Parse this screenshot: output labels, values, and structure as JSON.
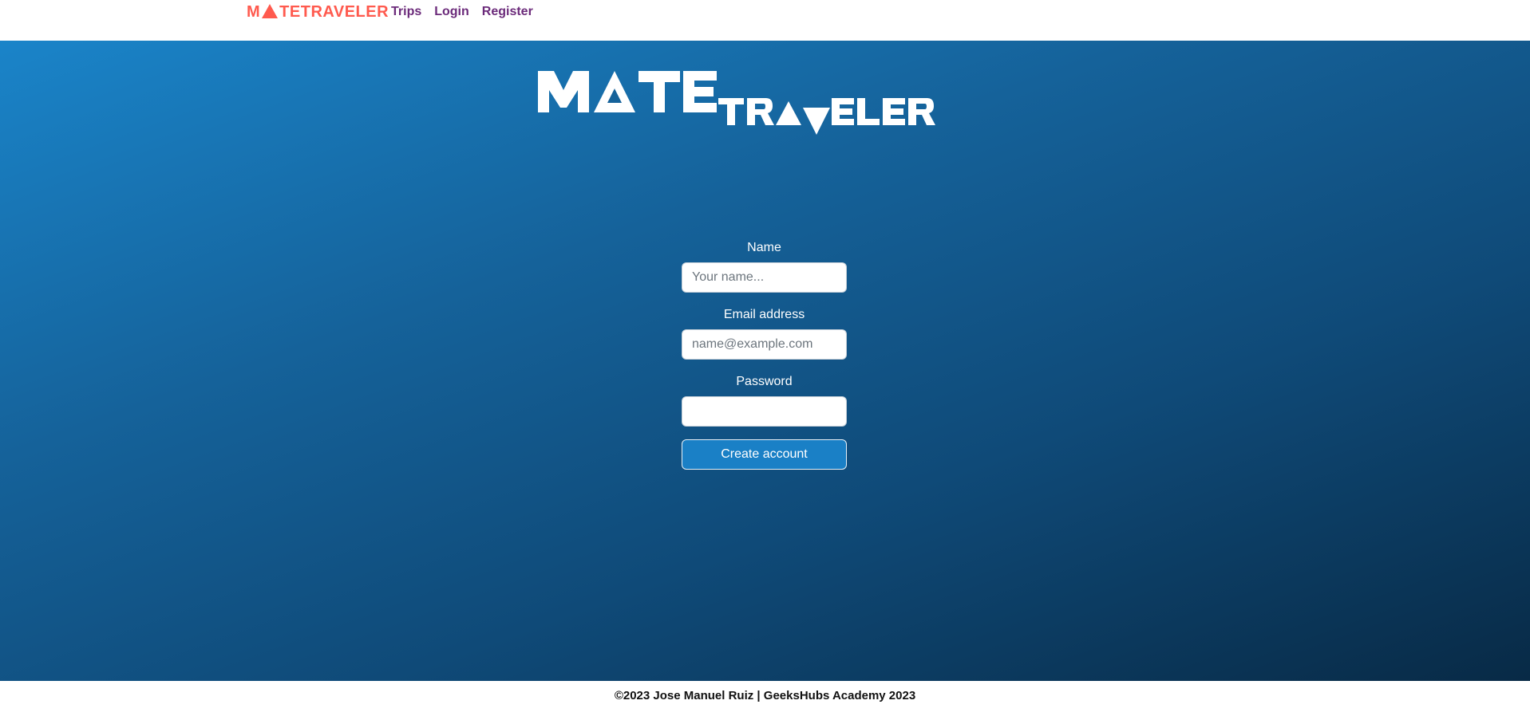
{
  "navbar": {
    "brand_prefix": "M",
    "brand_suffix": "TETRAVELER",
    "brand_color": "#ff5a4e",
    "links": [
      {
        "label": "Trips"
      },
      {
        "label": "Login"
      },
      {
        "label": "Register"
      }
    ],
    "link_color": "#6b2a7a"
  },
  "hero": {
    "logo": {
      "word_1": "MATE",
      "word_2": "TRAVELER",
      "icon": "triangle-icon"
    },
    "form": {
      "name_label": "Name",
      "name_placeholder": "Your name...",
      "name_value": "",
      "email_label": "Email address",
      "email_placeholder": "name@example.com",
      "email_value": "",
      "password_label": "Password",
      "password_value": "",
      "submit_label": "Create account"
    },
    "gradient_colors": [
      "#1a84c9",
      "#082a46"
    ]
  },
  "footer": {
    "text": "©2023 Jose Manuel Ruiz | GeeksHubs Academy 2023"
  }
}
